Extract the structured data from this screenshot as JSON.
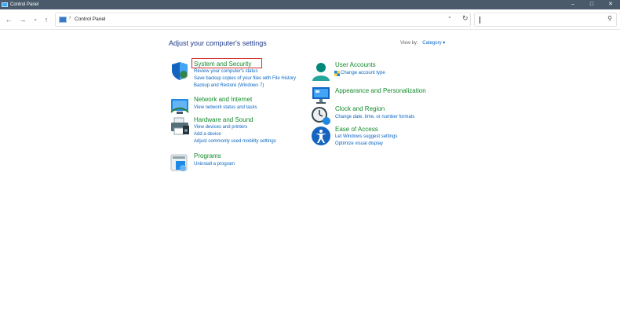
{
  "window": {
    "title": "Control Panel",
    "controls": [
      "–",
      "□",
      "✕"
    ]
  },
  "address": {
    "path": "Control Panel"
  },
  "header": {
    "title": "Adjust your computer's settings",
    "view_by_label": "View by:",
    "view_by_value": "Category ▾"
  },
  "categories": [
    {
      "title": "System and Security",
      "links": [
        "Review your computer's status",
        "Save backup copies of your files with File History",
        "Backup and Restore (Windows 7)"
      ],
      "icon": "shield-icon"
    },
    {
      "title": "Network and Internet",
      "links": [
        "View network status and tasks"
      ],
      "icon": "network-icon"
    },
    {
      "title": "Hardware and Sound",
      "links": [
        "View devices and printers",
        "Add a device",
        "Adjust commonly used mobility settings"
      ],
      "icon": "printer-icon"
    },
    {
      "title": "Programs",
      "links": [
        "Uninstall a program"
      ],
      "icon": "programs-icon"
    },
    {
      "title": "User Accounts",
      "links": [
        "Change account type"
      ],
      "icon": "user-icon"
    },
    {
      "title": "Appearance and Personalization",
      "links": [],
      "icon": "display-icon"
    },
    {
      "title": "Clock and Region",
      "links": [
        "Change date, time, or number formats"
      ],
      "icon": "clock-icon"
    },
    {
      "title": "Ease of Access",
      "links": [
        "Let Windows suggest settings",
        "Optimize visual display"
      ],
      "icon": "accessibility-icon"
    }
  ],
  "colors": {
    "title_green": "#128a2b",
    "link_blue": "#0a66c2",
    "heading_blue": "#1e3a8a",
    "highlight_red": "#d32f2f"
  }
}
